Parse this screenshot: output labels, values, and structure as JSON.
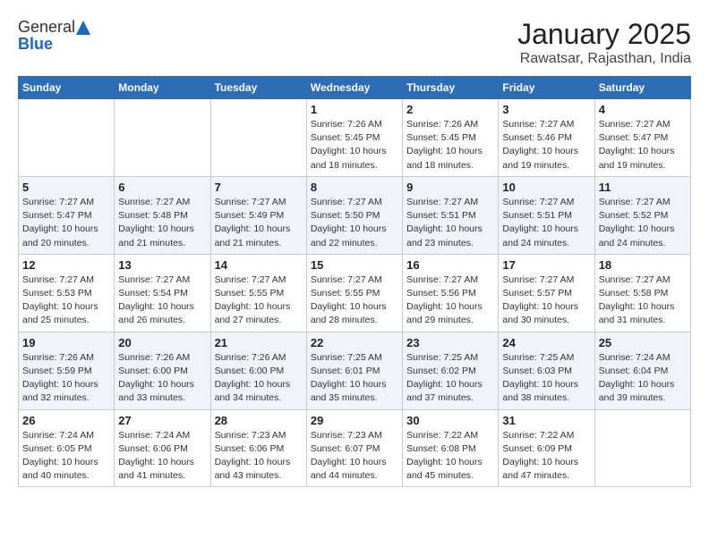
{
  "header": {
    "logo_general": "General",
    "logo_blue": "Blue",
    "month_title": "January 2025",
    "location": "Rawatsar, Rajasthan, India"
  },
  "days_of_week": [
    "Sunday",
    "Monday",
    "Tuesday",
    "Wednesday",
    "Thursday",
    "Friday",
    "Saturday"
  ],
  "weeks": [
    [
      {
        "day": "",
        "info": ""
      },
      {
        "day": "",
        "info": ""
      },
      {
        "day": "",
        "info": ""
      },
      {
        "day": "1",
        "info": "Sunrise: 7:26 AM\nSunset: 5:45 PM\nDaylight: 10 hours and 18 minutes."
      },
      {
        "day": "2",
        "info": "Sunrise: 7:26 AM\nSunset: 5:45 PM\nDaylight: 10 hours and 18 minutes."
      },
      {
        "day": "3",
        "info": "Sunrise: 7:27 AM\nSunset: 5:46 PM\nDaylight: 10 hours and 19 minutes."
      },
      {
        "day": "4",
        "info": "Sunrise: 7:27 AM\nSunset: 5:47 PM\nDaylight: 10 hours and 19 minutes."
      }
    ],
    [
      {
        "day": "5",
        "info": "Sunrise: 7:27 AM\nSunset: 5:47 PM\nDaylight: 10 hours and 20 minutes."
      },
      {
        "day": "6",
        "info": "Sunrise: 7:27 AM\nSunset: 5:48 PM\nDaylight: 10 hours and 21 minutes."
      },
      {
        "day": "7",
        "info": "Sunrise: 7:27 AM\nSunset: 5:49 PM\nDaylight: 10 hours and 21 minutes."
      },
      {
        "day": "8",
        "info": "Sunrise: 7:27 AM\nSunset: 5:50 PM\nDaylight: 10 hours and 22 minutes."
      },
      {
        "day": "9",
        "info": "Sunrise: 7:27 AM\nSunset: 5:51 PM\nDaylight: 10 hours and 23 minutes."
      },
      {
        "day": "10",
        "info": "Sunrise: 7:27 AM\nSunset: 5:51 PM\nDaylight: 10 hours and 24 minutes."
      },
      {
        "day": "11",
        "info": "Sunrise: 7:27 AM\nSunset: 5:52 PM\nDaylight: 10 hours and 24 minutes."
      }
    ],
    [
      {
        "day": "12",
        "info": "Sunrise: 7:27 AM\nSunset: 5:53 PM\nDaylight: 10 hours and 25 minutes."
      },
      {
        "day": "13",
        "info": "Sunrise: 7:27 AM\nSunset: 5:54 PM\nDaylight: 10 hours and 26 minutes."
      },
      {
        "day": "14",
        "info": "Sunrise: 7:27 AM\nSunset: 5:55 PM\nDaylight: 10 hours and 27 minutes."
      },
      {
        "day": "15",
        "info": "Sunrise: 7:27 AM\nSunset: 5:55 PM\nDaylight: 10 hours and 28 minutes."
      },
      {
        "day": "16",
        "info": "Sunrise: 7:27 AM\nSunset: 5:56 PM\nDaylight: 10 hours and 29 minutes."
      },
      {
        "day": "17",
        "info": "Sunrise: 7:27 AM\nSunset: 5:57 PM\nDaylight: 10 hours and 30 minutes."
      },
      {
        "day": "18",
        "info": "Sunrise: 7:27 AM\nSunset: 5:58 PM\nDaylight: 10 hours and 31 minutes."
      }
    ],
    [
      {
        "day": "19",
        "info": "Sunrise: 7:26 AM\nSunset: 5:59 PM\nDaylight: 10 hours and 32 minutes."
      },
      {
        "day": "20",
        "info": "Sunrise: 7:26 AM\nSunset: 6:00 PM\nDaylight: 10 hours and 33 minutes."
      },
      {
        "day": "21",
        "info": "Sunrise: 7:26 AM\nSunset: 6:00 PM\nDaylight: 10 hours and 34 minutes."
      },
      {
        "day": "22",
        "info": "Sunrise: 7:25 AM\nSunset: 6:01 PM\nDaylight: 10 hours and 35 minutes."
      },
      {
        "day": "23",
        "info": "Sunrise: 7:25 AM\nSunset: 6:02 PM\nDaylight: 10 hours and 37 minutes."
      },
      {
        "day": "24",
        "info": "Sunrise: 7:25 AM\nSunset: 6:03 PM\nDaylight: 10 hours and 38 minutes."
      },
      {
        "day": "25",
        "info": "Sunrise: 7:24 AM\nSunset: 6:04 PM\nDaylight: 10 hours and 39 minutes."
      }
    ],
    [
      {
        "day": "26",
        "info": "Sunrise: 7:24 AM\nSunset: 6:05 PM\nDaylight: 10 hours and 40 minutes."
      },
      {
        "day": "27",
        "info": "Sunrise: 7:24 AM\nSunset: 6:06 PM\nDaylight: 10 hours and 41 minutes."
      },
      {
        "day": "28",
        "info": "Sunrise: 7:23 AM\nSunset: 6:06 PM\nDaylight: 10 hours and 43 minutes."
      },
      {
        "day": "29",
        "info": "Sunrise: 7:23 AM\nSunset: 6:07 PM\nDaylight: 10 hours and 44 minutes."
      },
      {
        "day": "30",
        "info": "Sunrise: 7:22 AM\nSunset: 6:08 PM\nDaylight: 10 hours and 45 minutes."
      },
      {
        "day": "31",
        "info": "Sunrise: 7:22 AM\nSunset: 6:09 PM\nDaylight: 10 hours and 47 minutes."
      },
      {
        "day": "",
        "info": ""
      }
    ]
  ]
}
